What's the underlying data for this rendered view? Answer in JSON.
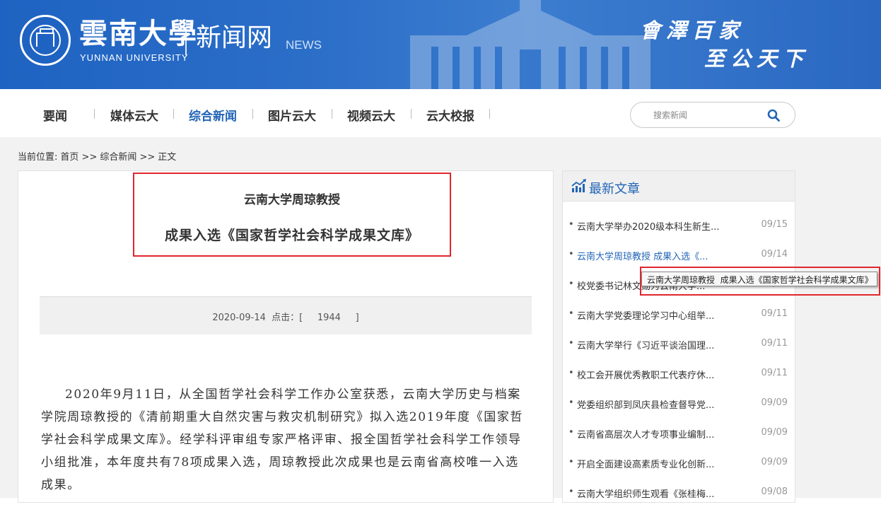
{
  "banner": {
    "brand_cn": "雲南大學",
    "brand_en": "YUNNAN UNIVERSITY",
    "site_name": "新闻网",
    "site_en": "NEWS",
    "motto_line1": "會澤百家",
    "motto_line2": "至公天下"
  },
  "nav": {
    "items": [
      {
        "label": "要闻"
      },
      {
        "label": "媒体云大"
      },
      {
        "label": "综合新闻",
        "active": true
      },
      {
        "label": "图片云大"
      },
      {
        "label": "视频云大"
      },
      {
        "label": "云大校报"
      }
    ],
    "search_placeholder": "搜索新闻"
  },
  "breadcrumb": {
    "prefix": "当前位置:",
    "home": "首页",
    "sep1": ">>",
    "section": "综合新闻",
    "sep2": ">>",
    "current": "正文"
  },
  "article": {
    "title_line1": "云南大学周琼教授",
    "title_line2": "成果入选《国家哲学社会科学成果文库》",
    "meta": "2020-09-14  点击：[     1944     ]",
    "body": "2020年9月11日，从全国哲学社会科学工作办公室获悉，云南大学历史与档案学院周琼教授的《清前期重大自然灾害与救灾机制研究》拟入选2019年度《国家哲学社会科学成果文库》。经学科评审组专家严格评审、报全国哲学社会科学工作领导小组批准，本年度共有78项成果入选，周琼教授此次成果也是云南省高校唯一入选成果。"
  },
  "sidebar": {
    "title": "最新文章",
    "items": [
      {
        "title": "云南大学举办2020级本科生新生...",
        "date": "09/15"
      },
      {
        "title": "云南大学周琼教授 成果入选《...",
        "date": "09/14",
        "highlight": true
      },
      {
        "title": "校党委书记林文勋为云南大学...",
        "date": "09/11"
      },
      {
        "title": "云南大学党委理论学习中心组举...",
        "date": "09/11"
      },
      {
        "title": "云南大学举行《习近平谈治国理...",
        "date": "09/11"
      },
      {
        "title": "校工会开展优秀教职工代表疗休...",
        "date": "09/11"
      },
      {
        "title": "党委组织部到凤庆县检查督导党...",
        "date": "09/09"
      },
      {
        "title": "云南省高层次人才专项事业编制...",
        "date": "09/09"
      },
      {
        "title": "开启全面建设高素质专业化创新...",
        "date": "09/09"
      },
      {
        "title": "云南大学组织师生观看《张桂梅...",
        "date": "09/08"
      }
    ]
  },
  "tooltip": {
    "text": "云南大学周琼教授  成果入选《国家哲学社会科学成果文库》"
  },
  "colors": {
    "banner_blue": "#2b6ec8",
    "accent_blue": "#2265b6",
    "highlight_red": "#e0262d"
  }
}
